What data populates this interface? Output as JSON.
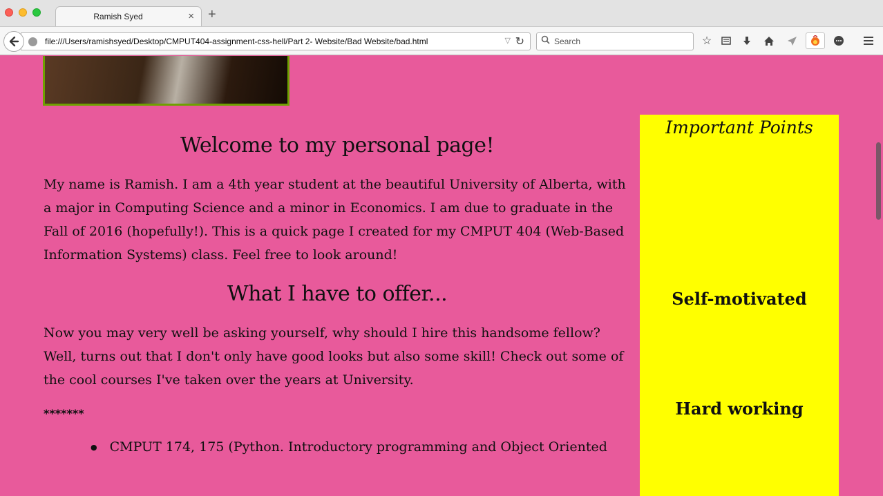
{
  "browser": {
    "tab_title": "Ramish Syed",
    "tab_close": "×",
    "new_tab": "+",
    "url": "file:///Users/ramishsyed/Desktop/CMPUT404-assignment-css-hell/Part 2- Website/Bad Website/bad.html",
    "search_placeholder": "Search",
    "icons": [
      "back-arrow-icon",
      "globe-icon",
      "reload-icon",
      "search-icon",
      "bookmark-star-icon",
      "reading-list-icon",
      "download-icon",
      "home-icon",
      "send-icon",
      "firebug-icon",
      "chat-icon",
      "menu-icon"
    ]
  },
  "page": {
    "heading": "Welcome to my personal page!",
    "intro": "My name is Ramish. I am a 4th year student at the beautiful University of Alberta, with a major in Computing Science and a minor in Economics. I am due to graduate in the Fall of 2016 (hopefully!). This is a quick page I created for my CMPUT 404 (Web-Based Information Systems) class. Feel free to look around!",
    "offer_heading": "What I have to offer...",
    "offer_text": "Now you may very well be asking yourself, why should I hire this handsome fellow? Well, turns out that I don't only have good looks but also some skill! Check out some of the cool courses I've taken over the years at University.",
    "separator": "*******",
    "courses": [
      "CMPUT 174, 175 (Python. Introductory programming and Object Oriented"
    ]
  },
  "sidebar": {
    "title": "Important Points",
    "items": [
      "Self-motivated",
      "Hard working"
    ]
  },
  "colors": {
    "page_background": "#e85a9b",
    "sidebar_background": "#ffff00",
    "photo_border": "#6ea100"
  }
}
